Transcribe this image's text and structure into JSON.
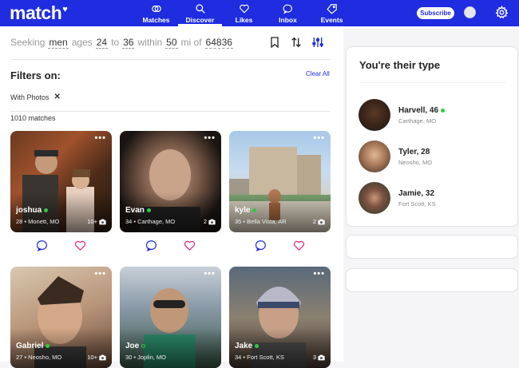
{
  "app": {
    "logo": "match",
    "brand_color": "#1f2ce0"
  },
  "nav": {
    "items": [
      {
        "label": "Matches",
        "icon": "rings-icon"
      },
      {
        "label": "Discover",
        "icon": "search-icon",
        "active": true
      },
      {
        "label": "Likes",
        "icon": "heart-icon"
      },
      {
        "label": "Inbox",
        "icon": "chat-bubble-icon"
      },
      {
        "label": "Events",
        "icon": "tag-icon"
      }
    ],
    "subscribe_label": "Subscribe"
  },
  "search": {
    "seeking_label": "Seeking",
    "gender": "men",
    "ages_label": "ages",
    "age_min": "24",
    "to_label": "to",
    "age_max": "36",
    "within_label": "within",
    "distance": "50",
    "mi_of_label": "mi of",
    "zip": "64836"
  },
  "filters": {
    "title": "Filters on:",
    "clear_label": "Clear All",
    "chips": [
      "With Photos"
    ],
    "match_count": "1010 matches"
  },
  "profiles": [
    {
      "name": "joshua",
      "online": true,
      "age": "28",
      "city": "Monett, MO",
      "photo_count": "10+"
    },
    {
      "name": "Evan",
      "online": true,
      "age": "34",
      "city": "Carthage, MO",
      "photo_count": "2"
    },
    {
      "name": "kyle",
      "online": true,
      "age": "35",
      "city": "Bella Vista, AR",
      "photo_count": "2"
    },
    {
      "name": "Gabriel",
      "online": true,
      "age": "27",
      "city": "Neosho, MO",
      "photo_count": "10+"
    },
    {
      "name": "Joe",
      "online": false,
      "age": "30",
      "city": "Joplin, MO",
      "photo_count": ""
    },
    {
      "name": "Jake",
      "online": true,
      "age": "34",
      "city": "Fort Scott, KS",
      "photo_count": "3"
    }
  ],
  "sidebar": {
    "title": "You're their type",
    "people": [
      {
        "name": "Harvell, 46",
        "online": true,
        "location": "Carthage, MO"
      },
      {
        "name": "Tyler, 28",
        "online": false,
        "location": "Neosho, MO"
      },
      {
        "name": "Jamie, 32",
        "online": false,
        "location": "Fort Scott, KS"
      }
    ]
  }
}
